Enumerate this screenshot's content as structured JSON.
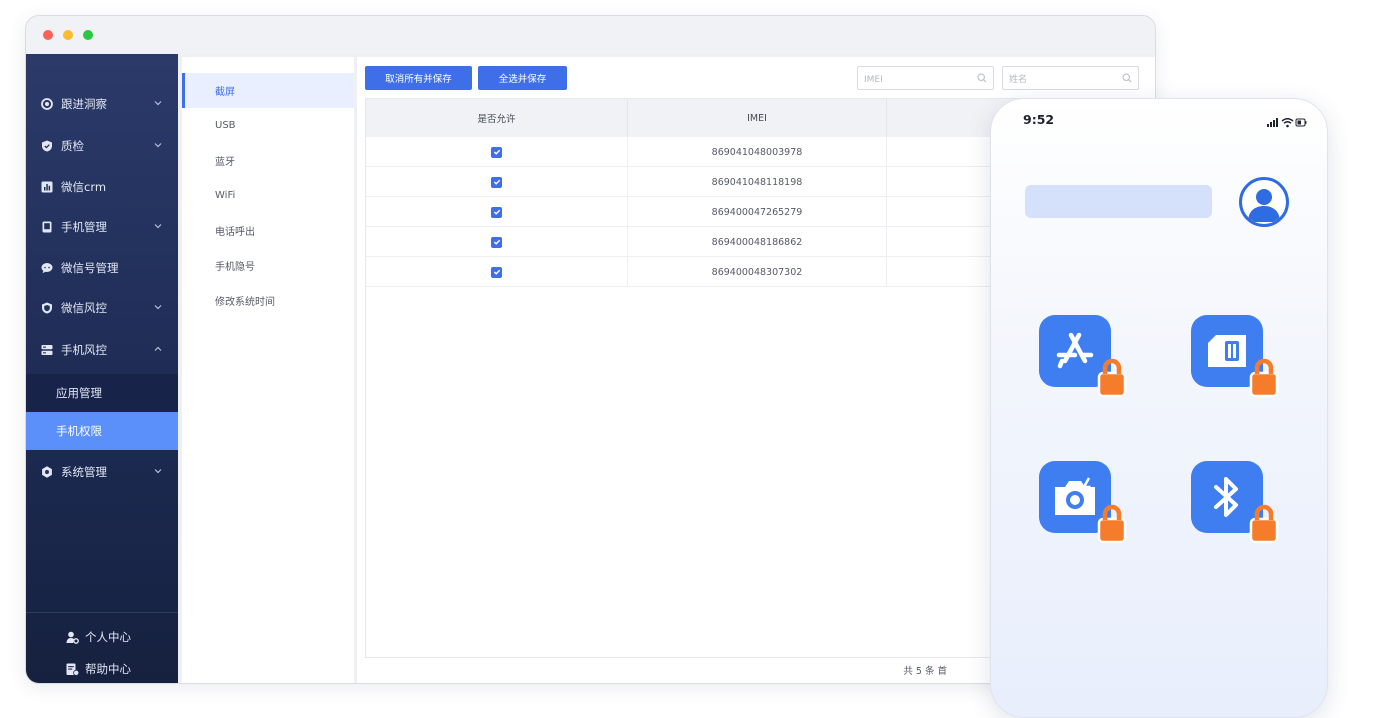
{
  "sidebar": {
    "items": [
      {
        "label": "跟进洞察",
        "icon": "eye-icon"
      },
      {
        "label": "质检",
        "icon": "shield-check-icon"
      },
      {
        "label": "微信crm",
        "icon": "bar-chart-icon"
      },
      {
        "label": "手机管理",
        "icon": "phone-icon"
      },
      {
        "label": "微信号管理",
        "icon": "chat-icon"
      },
      {
        "label": "微信风控",
        "icon": "shield-icon"
      },
      {
        "label": "手机风控",
        "icon": "server-icon"
      }
    ],
    "sub_items": [
      {
        "label": "应用管理"
      },
      {
        "label": "手机权限"
      }
    ],
    "system": {
      "label": "系统管理",
      "icon": "gear-icon"
    },
    "footer": {
      "personal": "个人中心",
      "help": "帮助中心"
    }
  },
  "submenu": {
    "items": [
      "截屏",
      "USB",
      "蓝牙",
      "WiFi",
      "电话呼出",
      "手机隐号",
      "修改系统时间"
    ],
    "active": "截屏"
  },
  "toolbar": {
    "cancel_all_label": "取消所有并保存",
    "select_all_label": "全选并保存",
    "imei_placeholder": "IMEI",
    "name_placeholder": "姓名"
  },
  "table": {
    "columns": [
      "是否允许",
      "IMEI"
    ],
    "rows": [
      {
        "allowed": true,
        "imei": "869041048003978"
      },
      {
        "allowed": true,
        "imei": "869041048118198"
      },
      {
        "allowed": true,
        "imei": "869400047265279"
      },
      {
        "allowed": true,
        "imei": "869400048186862"
      },
      {
        "allowed": true,
        "imei": "869400048307302"
      }
    ],
    "footer": "共 5 条   首"
  },
  "phone": {
    "time": "9:52",
    "apps": [
      "app-store-icon",
      "sim-card-icon",
      "camera-icon",
      "bluetooth-icon"
    ]
  },
  "colors": {
    "accent": "#3f6fe8",
    "sidebar": "#1d2b54",
    "lock": "#f57c2b",
    "app_tile": "#3f7ef0"
  }
}
